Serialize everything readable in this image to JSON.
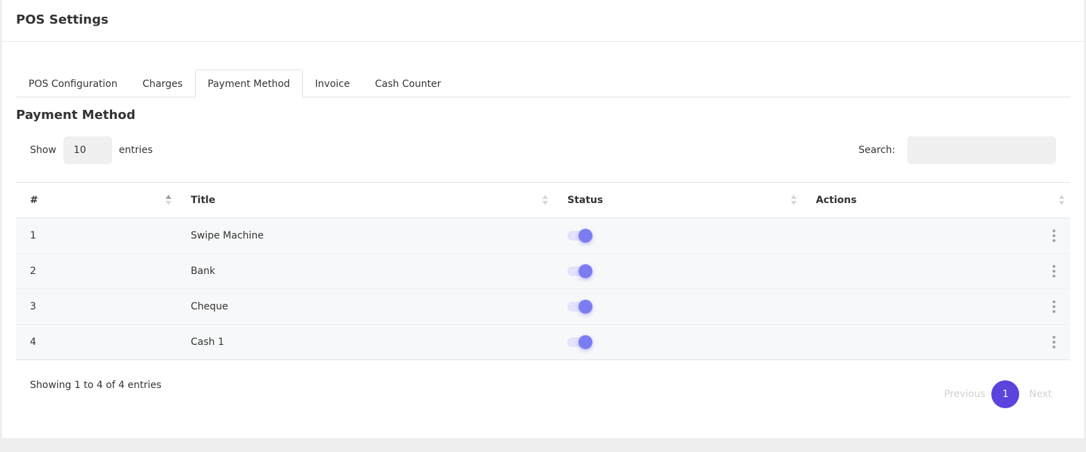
{
  "header": {
    "title": "POS Settings"
  },
  "tabs": [
    {
      "label": "POS Configuration",
      "active": false
    },
    {
      "label": "Charges",
      "active": false
    },
    {
      "label": "Payment Method",
      "active": true
    },
    {
      "label": "Invoice",
      "active": false
    },
    {
      "label": "Cash Counter",
      "active": false
    }
  ],
  "section": {
    "title": "Payment Method"
  },
  "length": {
    "show_label": "Show",
    "value": "10",
    "entries_label": "entries"
  },
  "search": {
    "label": "Search:",
    "value": "",
    "placeholder": ""
  },
  "table": {
    "columns": [
      "#",
      "Title",
      "Status",
      "Actions"
    ],
    "rows": [
      {
        "num": "1",
        "title": "Swipe Machine",
        "status": true
      },
      {
        "num": "2",
        "title": "Bank",
        "status": true
      },
      {
        "num": "3",
        "title": "Cheque",
        "status": true
      },
      {
        "num": "4",
        "title": "Cash 1",
        "status": true
      }
    ]
  },
  "footer": {
    "info": "Showing 1 to 4 of 4 entries",
    "previous": "Previous",
    "page": "1",
    "next": "Next"
  },
  "colors": {
    "accent": "#5b43dd",
    "toggle_knob": "#7c7cf2",
    "toggle_track": "#e3e3fb"
  },
  "icons": {
    "row_actions": "kebab-vertical-icon",
    "sort": "sort-arrows-icon"
  }
}
